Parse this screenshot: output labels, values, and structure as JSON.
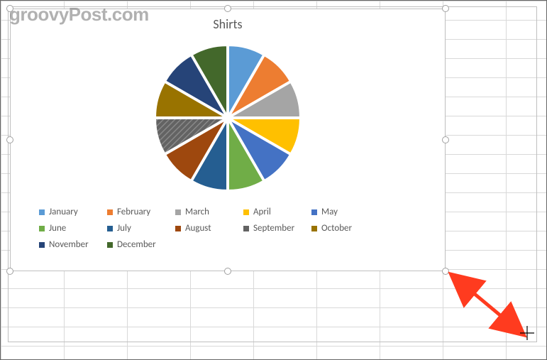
{
  "watermark": "groovyPost.com",
  "chart_data": {
    "type": "pie",
    "title": "Shirts",
    "series": [
      {
        "name": "January",
        "value": 8.33,
        "color": "#5B9BD5"
      },
      {
        "name": "February",
        "value": 8.33,
        "color": "#ED7D31"
      },
      {
        "name": "March",
        "value": 8.33,
        "color": "#A5A5A5"
      },
      {
        "name": "April",
        "value": 8.33,
        "color": "#FFC000"
      },
      {
        "name": "May",
        "value": 8.33,
        "color": "#4472C4"
      },
      {
        "name": "June",
        "value": 8.33,
        "color": "#70AD47"
      },
      {
        "name": "July",
        "value": 8.33,
        "color": "#255E91"
      },
      {
        "name": "August",
        "value": 8.33,
        "color": "#9E480E"
      },
      {
        "name": "September",
        "value": 8.33,
        "color": "#636363"
      },
      {
        "name": "October",
        "value": 8.33,
        "color": "#997300"
      },
      {
        "name": "November",
        "value": 8.33,
        "color": "#264478"
      },
      {
        "name": "December",
        "value": 8.33,
        "color": "#43682B"
      }
    ],
    "exploded": true,
    "legend_position": "bottom"
  },
  "colors": {
    "grid": "#d9d9d9",
    "selection": "#bfbfbf",
    "arrow": "#ff3b1f"
  }
}
